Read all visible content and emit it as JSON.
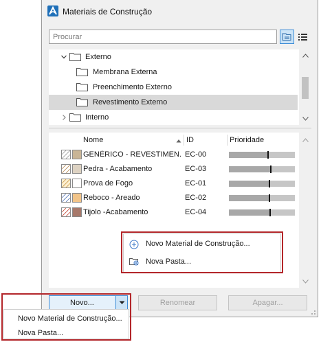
{
  "window": {
    "title": "Materiais de Construção"
  },
  "search": {
    "placeholder": "Procurar"
  },
  "tree": {
    "items": [
      {
        "label": "Externo"
      },
      {
        "label": "Membrana Externa"
      },
      {
        "label": "Preenchimento Externo"
      },
      {
        "label": "Revestimento Externo"
      },
      {
        "label": "Interno"
      }
    ]
  },
  "list": {
    "headers": {
      "name": "Nome",
      "id": "ID",
      "priority": "Prioridade"
    },
    "rows": [
      {
        "name": "GENÉRICO - REVESTIMEN...",
        "id": "EC-00",
        "priority": 0.58
      },
      {
        "name": "Pedra - Acabamento",
        "id": "EC-03",
        "priority": 0.62
      },
      {
        "name": "Prova de Fogo",
        "id": "EC-01",
        "priority": 0.6
      },
      {
        "name": "Reboco - Areado",
        "id": "EC-02",
        "priority": 0.6
      },
      {
        "name": "Tijolo -Acabamento",
        "id": "EC-04",
        "priority": 0.61
      }
    ]
  },
  "context_menu": {
    "items": [
      {
        "label": "Novo Material de Construção..."
      },
      {
        "label": "Nova Pasta..."
      }
    ]
  },
  "buttons": {
    "new": "Novo...",
    "rename": "Renomear",
    "delete": "Apagar..."
  },
  "dropdown": {
    "items": [
      {
        "label": "Novo Material de Construção..."
      },
      {
        "label": "Nova Pasta..."
      }
    ]
  },
  "colors": {
    "accent": "#3c8cd6",
    "highlight_border": "#b3262a",
    "selected_row": "#d9d9d9"
  }
}
